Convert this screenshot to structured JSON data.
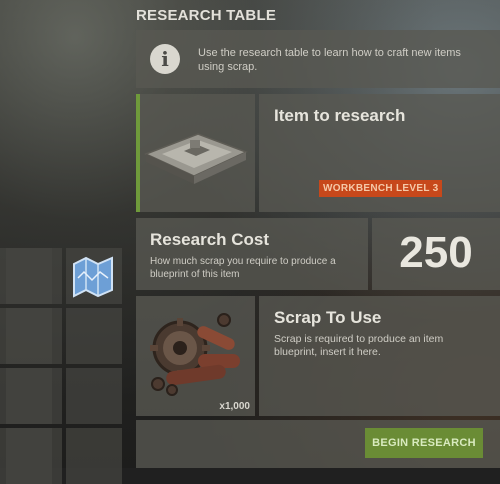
{
  "window": {
    "title": "RESEARCH TABLE"
  },
  "info": {
    "icon": "info-icon",
    "icon_glyph": "i",
    "text": "Use the research table to learn how to craft new items using scrap."
  },
  "item": {
    "heading": "Item to research",
    "slot_icon": "workbench-item-icon",
    "badge": "WORKBENCH LEVEL 3",
    "badge_color": "#c7481b",
    "slot_accent_color": "#6f9a3b"
  },
  "cost": {
    "heading": "Research Cost",
    "description": "How much scrap you require to produce a blueprint of this item",
    "value": "250"
  },
  "scrap": {
    "heading": "Scrap To Use",
    "description": "Scrap is required to produce an item blueprint, insert it here.",
    "slot_icon": "scrap-pile-icon",
    "quantity": "x1,000"
  },
  "actions": {
    "begin_label": "BEGIN RESEARCH",
    "button_color": "#6a8c35"
  },
  "inventory": {
    "item_icon": "blueprint-map-icon"
  }
}
